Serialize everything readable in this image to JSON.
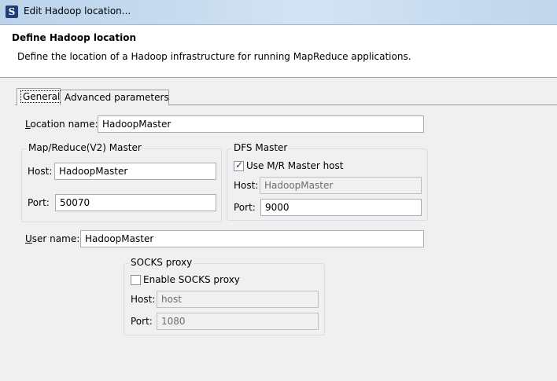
{
  "window": {
    "title": "Edit Hadoop location..."
  },
  "header": {
    "title": "Define Hadoop location",
    "description": "Define the location of a Hadoop infrastructure for running MapReduce applications."
  },
  "tabs": [
    {
      "label": "General",
      "selected": true
    },
    {
      "label": "Advanced parameters",
      "selected": false
    }
  ],
  "general": {
    "location_name_label": "Location name:",
    "location_name_value": "HadoopMaster",
    "mapreduce": {
      "title": "Map/Reduce(V2) Master",
      "host_label": "Host:",
      "host_value": "HadoopMaster",
      "port_label": "Port:",
      "port_value": "50070"
    },
    "dfs": {
      "title": "DFS Master",
      "use_mr_host_label": "Use M/R Master host",
      "use_mr_host_checked": true,
      "host_label": "Host:",
      "host_value": "HadoopMaster",
      "port_label": "Port:",
      "port_value": "9000"
    },
    "user_name_label": "User name:",
    "user_name_value": "HadoopMaster",
    "socks": {
      "title": "SOCKS proxy",
      "enable_label": "Enable SOCKS proxy",
      "enable_checked": false,
      "host_label": "Host:",
      "host_value": "host",
      "port_label": "Port:",
      "port_value": "1080"
    }
  },
  "colors": {
    "title_bar": "#c9dcef",
    "background": "#f0f0f0",
    "input_border": "#abadb3"
  }
}
